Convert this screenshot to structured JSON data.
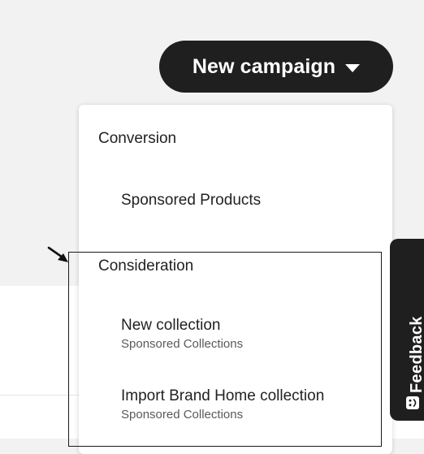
{
  "header": {
    "new_campaign_label": "New campaign",
    "dropdown_icon": "caret-down-icon"
  },
  "menu": {
    "groups": [
      {
        "heading": "Conversion",
        "items": [
          {
            "title": "Sponsored Products",
            "subtitle": ""
          }
        ]
      },
      {
        "heading": "Consideration",
        "items": [
          {
            "title": "New collection",
            "subtitle": "Sponsored Collections"
          },
          {
            "title": "Import Brand Home collection",
            "subtitle": "Sponsored Collections"
          }
        ]
      }
    ]
  },
  "feedback": {
    "label": "Feedback",
    "icon": "smiley-face-icon"
  },
  "colors": {
    "button_bg": "#1f1f1f",
    "page_bg": "#f2f2f2",
    "menu_bg": "#ffffff",
    "annotation": "#1a1a1a"
  }
}
